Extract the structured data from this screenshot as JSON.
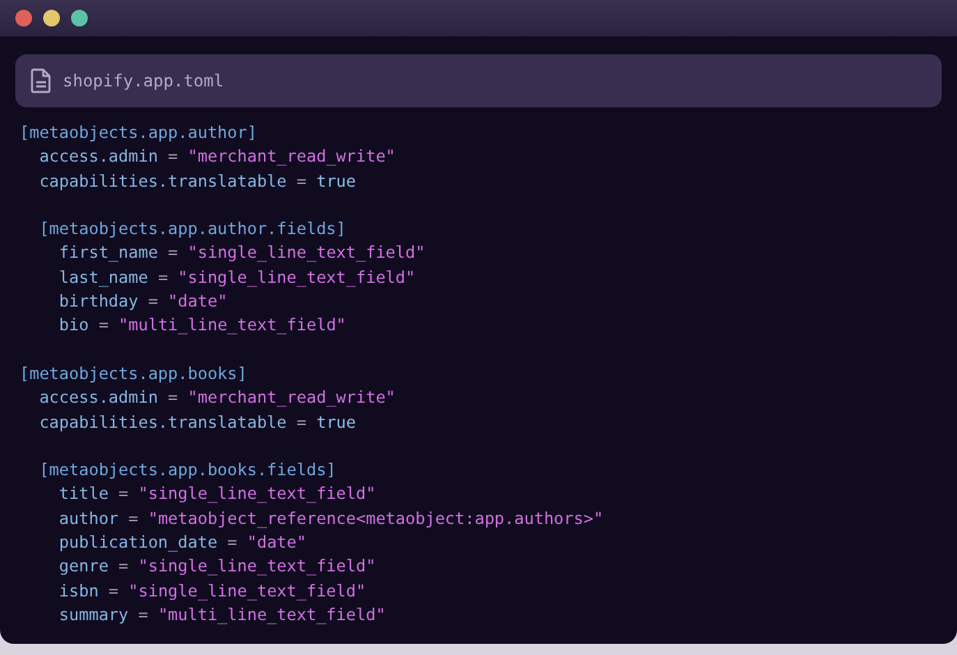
{
  "window": {
    "controls": [
      {
        "color": "#e0605a"
      },
      {
        "color": "#e3c76a"
      },
      {
        "color": "#5dc3a6"
      }
    ]
  },
  "file_tab": {
    "filename": "shopify.app.toml"
  },
  "tables": [
    {
      "header": "[metaobjects.app.author]",
      "entries": [
        {
          "key": "access.admin",
          "operator": "=",
          "value": "\"merchant_read_write\"",
          "kind": "string"
        },
        {
          "key": "capabilities.translatable",
          "operator": "=",
          "value": "true",
          "kind": "bool"
        }
      ],
      "children": [
        {
          "header": "[metaobjects.app.author.fields]",
          "entries": [
            {
              "key": "first_name",
              "operator": "=",
              "value": "\"single_line_text_field\"",
              "kind": "string"
            },
            {
              "key": "last_name",
              "operator": "=",
              "value": "\"single_line_text_field\"",
              "kind": "string"
            },
            {
              "key": "birthday",
              "operator": "=",
              "value": "\"date\"",
              "kind": "string"
            },
            {
              "key": "bio",
              "operator": "=",
              "value": "\"multi_line_text_field\"",
              "kind": "string"
            }
          ]
        }
      ]
    },
    {
      "header": "[metaobjects.app.books]",
      "entries": [
        {
          "key": "access.admin",
          "operator": "=",
          "value": "\"merchant_read_write\"",
          "kind": "string"
        },
        {
          "key": "capabilities.translatable",
          "operator": "=",
          "value": "true",
          "kind": "bool"
        }
      ],
      "children": [
        {
          "header": "[metaobjects.app.books.fields]",
          "entries": [
            {
              "key": "title",
              "operator": "=",
              "value": "\"single_line_text_field\"",
              "kind": "string"
            },
            {
              "key": "author",
              "operator": "=",
              "value": "\"metaobject_reference<metaobject:app.authors>\"",
              "kind": "string"
            },
            {
              "key": "publication_date",
              "operator": "=",
              "value": "\"date\"",
              "kind": "string"
            },
            {
              "key": "genre",
              "operator": "=",
              "value": "\"single_line_text_field\"",
              "kind": "string"
            },
            {
              "key": "isbn",
              "operator": "=",
              "value": "\"single_line_text_field\"",
              "kind": "string"
            },
            {
              "key": "summary",
              "operator": "=",
              "value": "\"multi_line_text_field\"",
              "kind": "string"
            }
          ]
        }
      ]
    }
  ]
}
